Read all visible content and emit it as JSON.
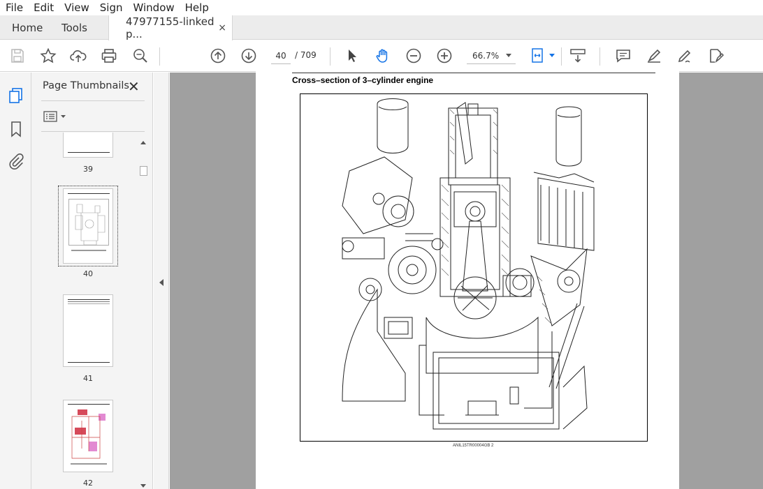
{
  "menu": [
    "File",
    "Edit",
    "View",
    "Sign",
    "Window",
    "Help"
  ],
  "tabs": {
    "home": "Home",
    "tools": "Tools",
    "document": "47977155-linked p...",
    "close_glyph": "×"
  },
  "toolbar": {
    "page_current": "40",
    "page_total": "/ 709",
    "zoom": "66.7%",
    "icons": [
      "save-icon",
      "star-icon",
      "upload-icon",
      "print-icon",
      "find-icon",
      "page-up-icon",
      "page-down-icon",
      "select-icon",
      "hand-icon",
      "zoom-out-icon",
      "zoom-in-icon",
      "fit-page-icon",
      "scroll-mode-icon",
      "comment-icon",
      "highlight-icon",
      "sign-icon",
      "fill-sign-icon"
    ]
  },
  "nav_rail": {
    "icons": [
      "page-thumbnails-icon",
      "bookmark-icon",
      "attachment-icon"
    ]
  },
  "thumbnail_panel": {
    "title": "Page Thumbnails",
    "close_glyph": "✕",
    "thumbnails": [
      {
        "page": "39"
      },
      {
        "page": "40",
        "selected": true
      },
      {
        "page": "41"
      },
      {
        "page": "42"
      }
    ]
  },
  "document": {
    "heading": "Cross–section of 3–cylinder engine",
    "figure_caption": "ANIL15TR00004GB    2"
  },
  "colors": {
    "accent": "#1473e6",
    "doc_background": "#a0a0a0",
    "panel_background": "#f4f4f4"
  }
}
